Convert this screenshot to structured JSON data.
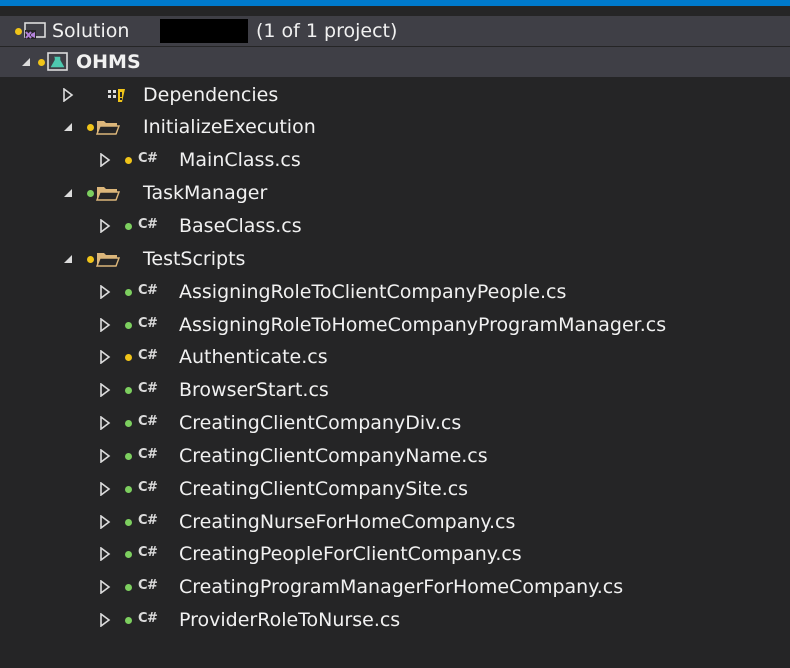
{
  "solution": {
    "label": "Solution",
    "suffix": "(1 of 1 project)"
  },
  "project": {
    "label": "OHMS"
  },
  "dependencies": {
    "label": "Dependencies"
  },
  "folders": {
    "initialize_execution": {
      "label": "InitializeExecution"
    },
    "task_manager": {
      "label": "TaskManager"
    },
    "test_scripts": {
      "label": "TestScripts"
    }
  },
  "files": {
    "main_class": "MainClass.cs",
    "base_class": "BaseClass.cs",
    "test_scripts": [
      {
        "name": "AssigningRoleToClientCompanyPeople.cs",
        "status": "green"
      },
      {
        "name": "AssigningRoleToHomeCompanyProgramManager.cs",
        "status": "green"
      },
      {
        "name": "Authenticate.cs",
        "status": "yellow"
      },
      {
        "name": "BrowserStart.cs",
        "status": "green"
      },
      {
        "name": "CreatingClientCompanyDiv.cs",
        "status": "green"
      },
      {
        "name": "CreatingClientCompanyName.cs",
        "status": "green"
      },
      {
        "name": "CreatingClientCompanySite.cs",
        "status": "green"
      },
      {
        "name": "CreatingNurseForHomeCompany.cs",
        "status": "green"
      },
      {
        "name": "CreatingPeopleForClientCompany.cs",
        "status": "green"
      },
      {
        "name": "CreatingProgramManagerForHomeCompany.cs",
        "status": "green"
      },
      {
        "name": "ProviderRoleToNurse.cs",
        "status": "green"
      }
    ]
  },
  "icons": {
    "cs_glyph": "C#"
  },
  "colors": {
    "background": "#252526",
    "selection": "#3f3f46",
    "accent": "#007acc",
    "pending_dot": "#f0c419",
    "checked_in_dot": "#7dcf5f",
    "folder": "#dcb67a",
    "text": "#f1f1f1"
  }
}
